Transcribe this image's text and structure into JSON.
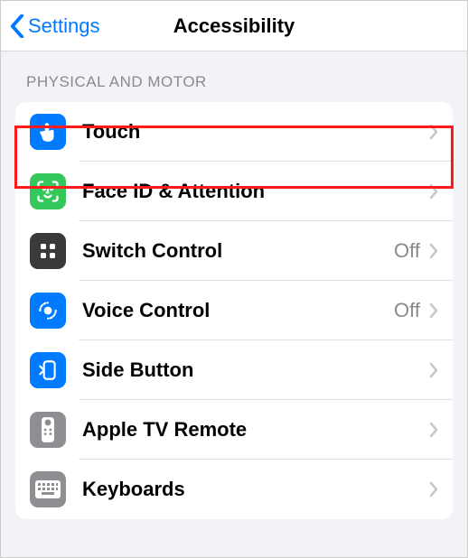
{
  "header": {
    "back_label": "Settings",
    "title": "Accessibility"
  },
  "section": {
    "title": "PHYSICAL AND MOTOR"
  },
  "rows": [
    {
      "label": "Touch",
      "status": ""
    },
    {
      "label": "Face ID & Attention",
      "status": ""
    },
    {
      "label": "Switch Control",
      "status": "Off"
    },
    {
      "label": "Voice Control",
      "status": "Off"
    },
    {
      "label": "Side Button",
      "status": ""
    },
    {
      "label": "Apple TV Remote",
      "status": ""
    },
    {
      "label": "Keyboards",
      "status": ""
    }
  ],
  "colors": {
    "accent": "#007aff",
    "green": "#34c759",
    "darkgray": "#8e8e93",
    "lightgray": "#c7c7cc"
  }
}
